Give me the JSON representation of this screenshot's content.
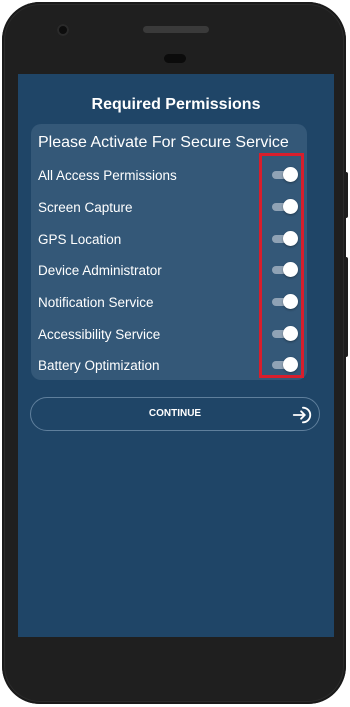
{
  "screen": {
    "title": "Required Permissions",
    "card_header": "Please Activate For Secure Service",
    "permissions": [
      {
        "label": "All Access Permissions",
        "enabled": true
      },
      {
        "label": "Screen Capture",
        "enabled": true
      },
      {
        "label": "GPS Location",
        "enabled": true
      },
      {
        "label": "Device Administrator",
        "enabled": true
      },
      {
        "label": "Notification Service",
        "enabled": true
      },
      {
        "label": "Accessibility Service",
        "enabled": true
      },
      {
        "label": "Battery Optimization",
        "enabled": true
      }
    ],
    "continue_label": "CONTINUE",
    "continue_icon": "login-arrow-icon"
  },
  "colors": {
    "screen_bg": "#1f4567",
    "card_bg": "#345878",
    "highlight": "#d81e2c",
    "phone_body": "#2b2b2b"
  }
}
